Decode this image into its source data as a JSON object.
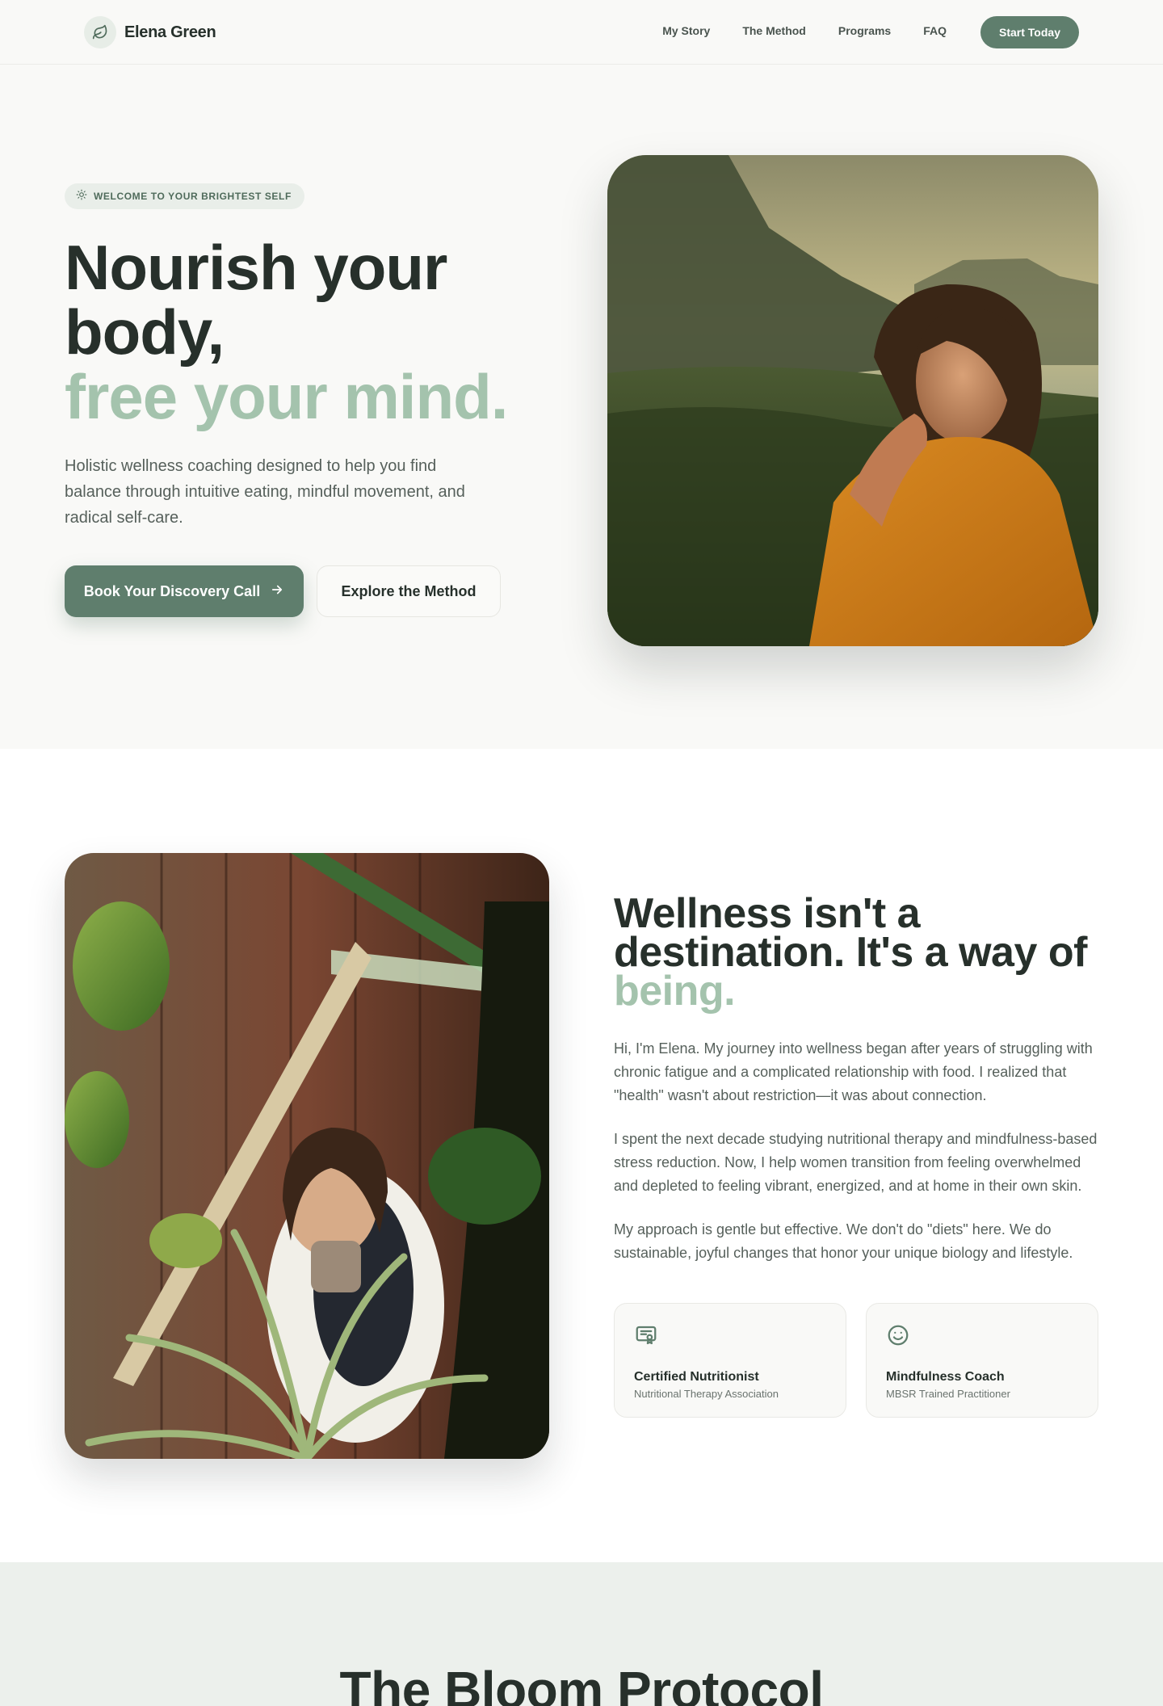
{
  "nav": {
    "brand": "Elena Green",
    "links": [
      "My Story",
      "The Method",
      "Programs",
      "FAQ"
    ],
    "cta": "Start Today"
  },
  "hero": {
    "eyebrow": "WELCOME TO YOUR BRIGHTEST SELF",
    "title_line1": "Nourish your",
    "title_line2": "body,",
    "title_accent": "free your mind.",
    "subtitle": "Holistic wellness coaching designed to help you find balance through intuitive eating, mindful movement, and radical self-care.",
    "primary_button": "Book Your Discovery Call",
    "secondary_button": "Explore the Method"
  },
  "about": {
    "title_main": "Wellness isn't a destination. It's a way of",
    "title_accent": "being.",
    "paragraphs": [
      "Hi, I'm Elena. My journey into wellness began after years of struggling with chronic fatigue and a complicated relationship with food. I realized that \"health\" wasn't about restriction—it was about connection.",
      "I spent the next decade studying nutritional therapy and mindfulness-based stress reduction. Now, I help women transition from feeling overwhelmed and depleted to feeling vibrant, energized, and at home in their own skin.",
      "My approach is gentle but effective. We don't do \"diets\" here. We do sustainable, joyful changes that honor your unique biology and lifestyle."
    ],
    "credentials": [
      {
        "title": "Certified Nutritionist",
        "subtitle": "Nutritional Therapy Association",
        "icon": "certificate-icon"
      },
      {
        "title": "Mindfulness Coach",
        "subtitle": "MBSR Trained Practitioner",
        "icon": "smile-icon"
      }
    ]
  },
  "protocol": {
    "title": "The Bloom Protocol"
  },
  "colors": {
    "accent": "#5f7e6d",
    "accent_light": "#a4c3ad",
    "text": "#27302b"
  }
}
